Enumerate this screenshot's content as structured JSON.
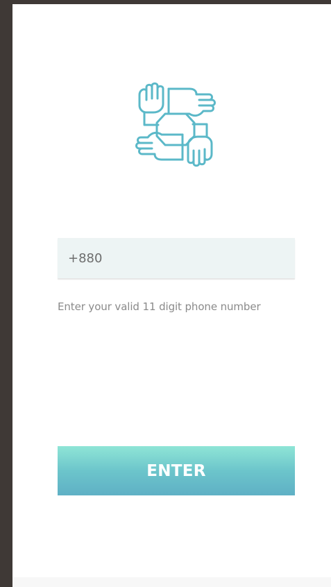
{
  "logo": {
    "icon": "teamwork-hands-icon",
    "color": "#5bb8c8"
  },
  "phone_input": {
    "value": "+880",
    "placeholder": ""
  },
  "hint": {
    "text": "Enter your valid 11 digit phone number"
  },
  "enter_button": {
    "label": "ENTER"
  },
  "colors": {
    "background_frame": "#3f3936",
    "screen": "#ffffff",
    "input_bg": "#edf4f4",
    "button_top": "#8fe5d6",
    "button_bottom": "#5fb0c5"
  }
}
